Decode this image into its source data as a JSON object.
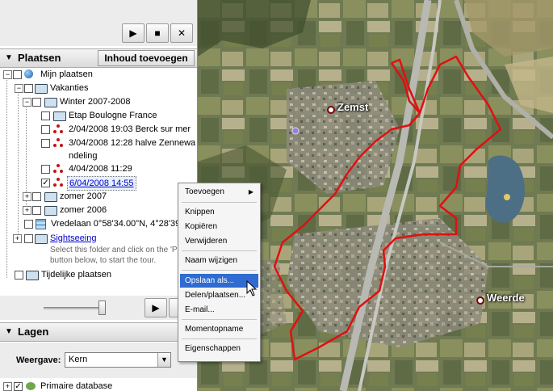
{
  "places_panel": {
    "title": "Plaatsen",
    "add_content_button": "Inhoud toevoegen",
    "tree": {
      "my_places": "Mijn plaatsen",
      "vacations": "Vakanties",
      "winter": "Winter 2007-2008",
      "etap": "Etap Boulogne France",
      "item1": "2/04/2008 19:03 Berck sur mer",
      "item2a": "3/04/2008 12:28 halve Zennewa",
      "item2b": "ndeling",
      "item3": "4/04/2008 11:29",
      "item4": "6/04/2008 14:55",
      "zomer2007": "zomer 2007",
      "zomer2006": "zomer 2006",
      "vredelaan": "Vredelaan 0°58'34.00\"N, 4°28'39.80",
      "sightseeing": "Sightseeing",
      "sightseeing_note1": "Select this folder and click on the 'P",
      "sightseeing_note2": "button below, to start the tour.",
      "temporary": "Tijdelijke plaatsen"
    }
  },
  "layers_panel": {
    "title": "Lagen",
    "view_label": "Weergave:",
    "view_value": "Kern",
    "primary_db": "Primaire database"
  },
  "context_menu": {
    "items": [
      "Toevoegen",
      "Knippen",
      "Kopiëren",
      "Verwijderen",
      "Naam wijzigen",
      "Opslaan als...",
      "Delen/plaatsen...",
      "E-mail...",
      "Momentopname",
      "Eigenschappen"
    ],
    "highlighted": "Opslaan als..."
  },
  "map": {
    "labels": [
      "Zemst",
      "Weerde"
    ],
    "route_color": "#e01010"
  },
  "colors": {
    "selection": "#2f6bd0",
    "link": "#0000cc"
  }
}
